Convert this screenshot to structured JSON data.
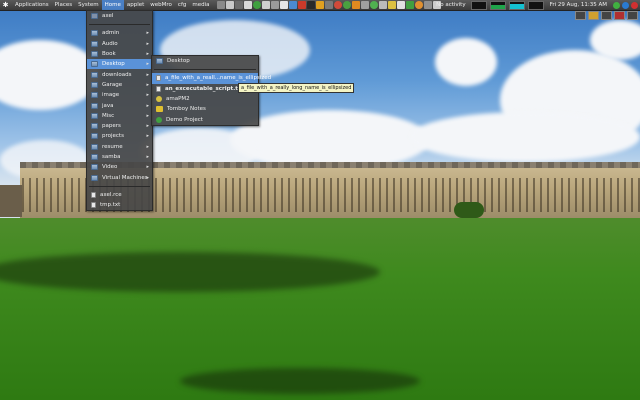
{
  "panel": {
    "menus": [
      {
        "label": "Applications"
      },
      {
        "label": "Places"
      },
      {
        "label": "System"
      },
      {
        "label": "Home"
      },
      {
        "label": "applet"
      },
      {
        "label": "webMro"
      },
      {
        "label": "cfg"
      },
      {
        "label": "media"
      }
    ],
    "activity_label": "No activity",
    "clock": "Fri 29 Aug, 11:35 AM"
  },
  "home_menu": {
    "items": [
      {
        "label": "axel",
        "icon": "home-icon",
        "submenu": false
      },
      {
        "label": "admin",
        "icon": "folder-icon",
        "submenu": true
      },
      {
        "label": "Audio",
        "icon": "folder-icon",
        "submenu": true
      },
      {
        "label": "Book",
        "icon": "folder-icon",
        "submenu": true
      },
      {
        "label": "Desktop",
        "icon": "folder-icon",
        "submenu": true
      },
      {
        "label": "downloads",
        "icon": "folder-icon",
        "submenu": true
      },
      {
        "label": "Garage",
        "icon": "folder-icon",
        "submenu": true
      },
      {
        "label": "image",
        "icon": "folder-icon",
        "submenu": true
      },
      {
        "label": "java",
        "icon": "folder-icon",
        "submenu": true
      },
      {
        "label": "Misc",
        "icon": "folder-icon",
        "submenu": true
      },
      {
        "label": "papers",
        "icon": "folder-icon",
        "submenu": true
      },
      {
        "label": "projects",
        "icon": "folder-icon",
        "submenu": true
      },
      {
        "label": "resume",
        "icon": "folder-icon",
        "submenu": true
      },
      {
        "label": "samba",
        "icon": "folder-icon",
        "submenu": true
      },
      {
        "label": "Video",
        "icon": "folder-icon",
        "submenu": true
      },
      {
        "label": "Virtual Machines",
        "icon": "folder-icon",
        "submenu": true
      },
      {
        "label": "axel.rce",
        "icon": "file-icon",
        "submenu": false
      },
      {
        "label": "tmp.txt",
        "icon": "file-icon",
        "submenu": false
      }
    ]
  },
  "desktop_menu": {
    "items": [
      {
        "label": "Desktop",
        "icon": "folder-icon"
      },
      {
        "label": "a_file_with_a_reall...name_is_ellipsized",
        "icon": "file-icon"
      },
      {
        "label": "an_excecutable_script.txt",
        "icon": "file-icon"
      },
      {
        "label": "amaPM2",
        "icon": "app-icon"
      },
      {
        "label": "Tomboy Notes",
        "icon": "notes-icon"
      },
      {
        "label": "Demo Project",
        "icon": "project-icon"
      }
    ]
  },
  "tooltip": "a_file_with_a_really_long_name_is_ellipsized",
  "colors": {
    "highlight": "#5a92d8",
    "menu_bg": "#464646",
    "tooltip_bg": "#f4f4c4"
  }
}
